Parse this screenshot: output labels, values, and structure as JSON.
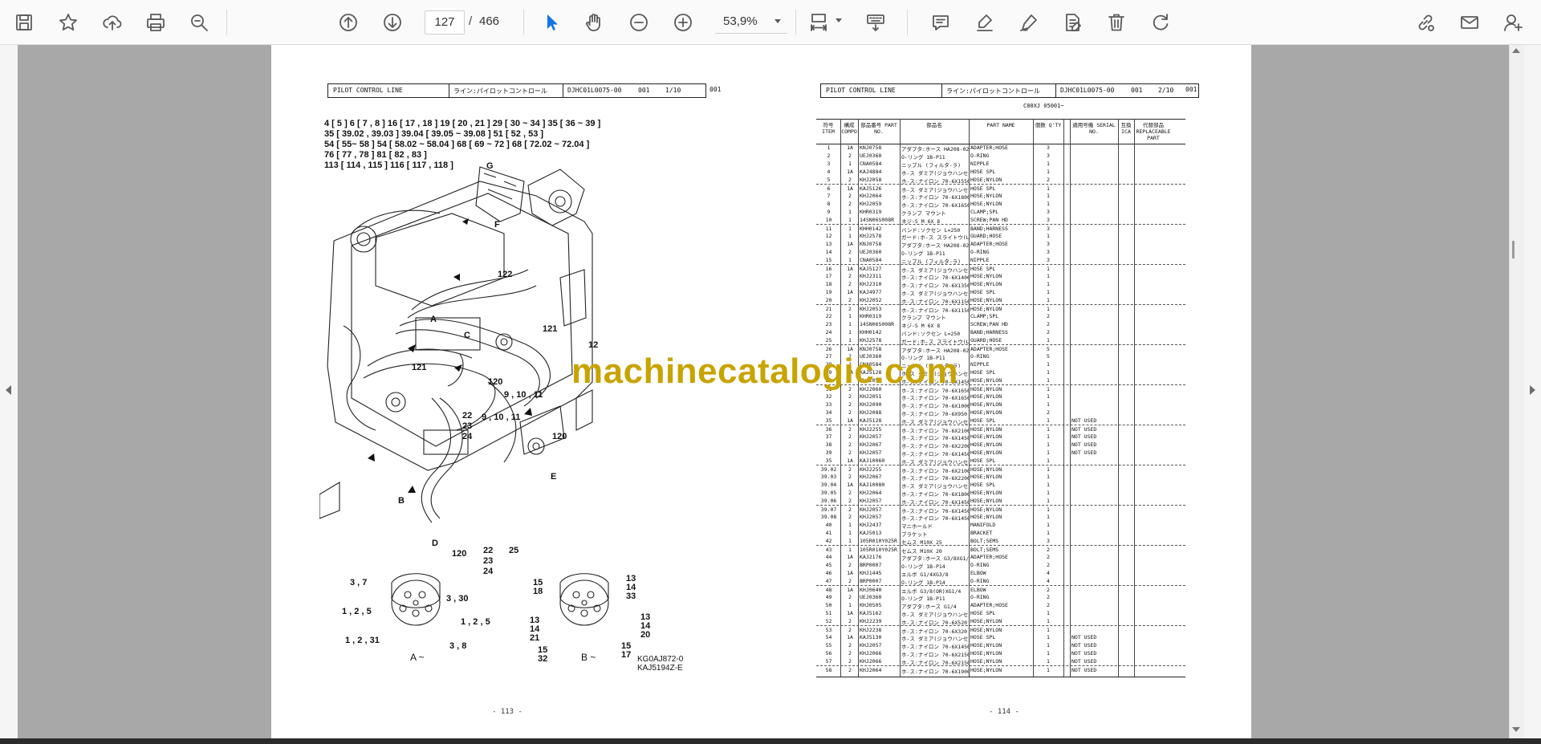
{
  "toolbar": {
    "page_current": "127",
    "page_separator": "/",
    "page_total": "466",
    "zoom": "53,9%",
    "icons": [
      "save-icon",
      "bookmark-star-icon",
      "upload-icon",
      "print-icon",
      "zoom-search-icon",
      "page-up-icon",
      "page-down-icon",
      "select-arrow-icon",
      "hand-icon",
      "zoom-out-icon",
      "zoom-in-icon",
      "fit-page-icon",
      "keyboard-icon",
      "comment-icon",
      "highlight-icon",
      "draw-icon",
      "edit-text-icon",
      "delete-icon",
      "rotate-icon",
      "share-link-icon",
      "email-icon",
      "add-user-icon"
    ],
    "accent": "#1473e6"
  },
  "watermark": "machinecatalogic.com",
  "left_page": {
    "header": {
      "title": "PILOT CONTROL LINE",
      "jp": "ライン:パイロットコントロール",
      "code": "DJHC01L0075-00",
      "rev": "001",
      "page": "1/10",
      "tail": "001"
    },
    "refs": [
      "4 [ 5 ]     6 [ 7 , 8 ]     16 [ 17 , 18 ]    19 [ 20 , 21 ]    29 [ 30 ~ 34 ]    35 [ 36 ~ 39 ]",
      "35 [ 39.02 , 39.03 ]    39.04 [ 39.05 ~ 39.08 ]     51 [ 52 , 53 ]",
      "54 [ 55~ 58 ]      54 [ 58.02 ~ 58.04 ]     68 [ 69 ~ 72 ]    68 [ 72.02 ~ 72.04 ]",
      "76 [ 77 , 78 ]     81 [ 82 , 83 ]",
      "113 [ 114 , 115 ]     116 [ 117 , 118 ]"
    ],
    "callouts": [
      "G",
      "F",
      "122",
      "A",
      "C",
      "121",
      "12",
      "121",
      "120",
      "9 , 10 , 11",
      "22",
      "23",
      "24",
      "9 , 10 , 11",
      "120",
      "E",
      "B",
      "D",
      "120",
      "22",
      "23",
      "24",
      "25"
    ],
    "detailA": {
      "labels": [
        "3 , 7",
        "3 , 30",
        "1 , 2 , 5",
        "1 , 2 , 5",
        "1 , 2 , 31",
        "3 , 8"
      ],
      "caption": "A ~"
    },
    "detailB": {
      "labels": [
        "13",
        "14",
        "33",
        "15",
        "18",
        "13",
        "14",
        "20",
        "13",
        "14",
        "21",
        "15",
        "32",
        "15",
        "17"
      ],
      "caption": "B ~"
    },
    "drawing_codes": [
      "KG0AJ872-0",
      "KAJ5194Z-E"
    ],
    "page_number": "- 113 -"
  },
  "right_page": {
    "header": {
      "title": "PILOT CONTROL LINE",
      "jp": "ライン:パイロットコントロール",
      "code": "DJHC01L0075-00",
      "rev": "001",
      "page": "2/10",
      "tail": "001"
    },
    "serial": "C80XJ 05001~",
    "columns": [
      "符号 ITEM",
      "構成 COMPO",
      "部品番号 PART NO.",
      "部品名",
      "PART NAME",
      "個数 Q'TY",
      "適用号機 SERIAL NO.",
      "互換 ICA",
      "代替部品 REPLACEABLE PART"
    ],
    "rows": [
      [
        "1",
        "1A",
        "KNJ0758",
        "アダプタ:ホース HA208-02",
        "ADAPTER;HOSE",
        "3",
        ""
      ],
      [
        "2",
        "2",
        "UEJ0360",
        "O-リング 1B-P11",
        "O-RING",
        "3",
        ""
      ],
      [
        "3",
        "1",
        "CNA0584",
        "ニップル (フィルタ-ラ)",
        "NIPPLE",
        "1",
        ""
      ],
      [
        "4",
        "1A",
        "KAJ4884",
        "ホ-ス ダミア(ジョウハンセイ",
        "HOSE SPL",
        "1",
        ""
      ],
      [
        "5",
        "2",
        "KHJ2058",
        "ホ-ス:ナイロン 70-6X1550 5",
        "HOSE;NYLON",
        "2",
        ""
      ],
      [
        "6",
        "1A",
        "KAJ5126",
        "ホ-ス ダミア(ジョウハンセイ",
        "HOSE SPL",
        "1",
        ""
      ],
      [
        "7",
        "2",
        "KHJ2064",
        "ホ-ス:ナイロン 70-6X1800 5",
        "HOSE;NYLON",
        "1",
        ""
      ],
      [
        "8",
        "2",
        "KHJ2059",
        "ホ-ス:ナイロン 70-6X1650 5",
        "HOSE;NYLON",
        "1",
        ""
      ],
      [
        "9",
        "1",
        "KHR0319",
        "クランプ マウント",
        "CLAMP;SPL",
        "3",
        ""
      ],
      [
        "10",
        "1",
        "14SN06S008R",
        "ネジ-S M 6X 8",
        "SCREW;PAN HD",
        "3",
        ""
      ],
      [
        "11",
        "1",
        "KHH0142",
        "バンド:ソクセン L=250",
        "BAND;HARNESS",
        "3",
        ""
      ],
      [
        "12",
        "1",
        "KHJ2578",
        "ガード:ホ-ス スライトウ(L=3",
        "GUARD;HOSE",
        "1",
        ""
      ],
      [
        "13",
        "1A",
        "KNJ0758",
        "アダプタ:ホース HA208-02",
        "ADAPTER;HOSE",
        "3",
        ""
      ],
      [
        "14",
        "2",
        "UEJ0360",
        "O-リング 1B-P11",
        "O-RING",
        "3",
        ""
      ],
      [
        "15",
        "1",
        "CNA0584",
        "ニップル (フィルタ-ラ)",
        "NIPPLE",
        "3",
        ""
      ],
      [
        "16",
        "1A",
        "KAJ5127",
        "ホ-ス ダミア(ジョウハンセイ",
        "HOSE SPL",
        "1",
        ""
      ],
      [
        "17",
        "2",
        "KHJ2311",
        "ホ-ス:ナイロン 70-6X1400 5",
        "HOSE;NYLON",
        "1",
        ""
      ],
      [
        "18",
        "2",
        "KHJ2310",
        "ホ-ス:ナイロン 70-6X1350 5",
        "HOSE;NYLON",
        "1",
        ""
      ],
      [
        "19",
        "1A",
        "KAJ4977",
        "ホ-ス ダミア(ジョウハンセイ",
        "HOSE SPL",
        "1",
        ""
      ],
      [
        "20",
        "2",
        "KHJ2052",
        "ホ-ス:ナイロン 70-6X1150 5",
        "HOSE;NYLON",
        "1",
        ""
      ],
      [
        "21",
        "2",
        "KHJ2053",
        "ホ-ス:ナイロン 70-6X1150 5",
        "HOSE;NYLON",
        "1",
        ""
      ],
      [
        "22",
        "1",
        "KHR0319",
        "クランプ マウント",
        "CLAMP;SPL",
        "2",
        ""
      ],
      [
        "23",
        "1",
        "14SN06S008R",
        "ネジ-S M 6X 8",
        "SCREW;PAN HD",
        "2",
        ""
      ],
      [
        "24",
        "1",
        "KHH0142",
        "バンド:ソクセン L=250",
        "BAND;HARNESS",
        "2",
        ""
      ],
      [
        "25",
        "1",
        "KHJ2578",
        "ガード:ホ-ス スライトウ(L=3",
        "GUARD;HOSE",
        "1",
        ""
      ],
      [
        "26",
        "1A",
        "KNJ0758",
        "アダプタ:ホース HA208-02",
        "ADAPTER;HOSE",
        "5",
        ""
      ],
      [
        "27",
        "2",
        "UEJ0360",
        "O-リング 1B-P11",
        "O-RING",
        "5",
        ""
      ],
      [
        "28",
        "1",
        "CNA0584",
        "ニップル (フィルタ-ラ)",
        "NIPPLE",
        "1",
        ""
      ],
      [
        "29",
        "1A",
        "KAJ5128",
        "ホ-ス ダミア(ジョウハンセイ",
        "HOSE SPL",
        "1",
        ""
      ],
      [
        "30",
        "2",
        "KHJ2057",
        "ホ-ス:ナイロン 70-6X1450 5",
        "HOSE;NYLON",
        "1",
        ""
      ],
      [
        "31",
        "2",
        "KHJ2060",
        "ホ-ス:ナイロン 70-6X1650 5",
        "HOSE;NYLON",
        "1",
        ""
      ],
      [
        "32",
        "2",
        "KHJ2051",
        "ホ-ス:ナイロン 70-6X1650 5",
        "HOSE;NYLON",
        "1",
        ""
      ],
      [
        "33",
        "2",
        "KHJ2090",
        "ホ-ス:ナイロン 70-6X1000 5",
        "HOSE;NYLON",
        "1",
        ""
      ],
      [
        "34",
        "2",
        "KHJ2088",
        "ホ-ス:ナイロン 70-6X950 54",
        "HOSE;NYLON",
        "2",
        ""
      ],
      [
        "35",
        "1A",
        "KAJ5128",
        "ホ-ス ダミア(ジョウハンセイ",
        "HOSE SPL",
        "1",
        "NOT USED"
      ],
      [
        "36",
        "2",
        "KHJ2255",
        "ホ-ス:ナイロン 70-6X2100 5",
        "HOSE;NYLON",
        "1",
        "NOT USED"
      ],
      [
        "37",
        "2",
        "KHJ2057",
        "ホ-ス:ナイロン 70-6X1450 5",
        "HOSE;NYLON",
        "1",
        "NOT USED"
      ],
      [
        "38",
        "2",
        "KHJ2067",
        "ホ-ス:ナイロン 70-6X2200 5",
        "HOSE;NYLON",
        "1",
        "NOT USED"
      ],
      [
        "39",
        "2",
        "KHJ2057",
        "ホ-ス:ナイロン 70-6X1450 5",
        "HOSE;NYLON",
        "1",
        "NOT USED"
      ],
      [
        "35",
        "1A",
        "KAJ10060",
        "ホ-ス ダミア(ジョウハンセイ",
        "HOSE SPL",
        "1",
        ""
      ],
      [
        "39.02",
        "2",
        "KHJ2255",
        "ホ-ス:ナイロン 70-6X2100 5",
        "HOSE;NYLON",
        "1",
        ""
      ],
      [
        "39.03",
        "2",
        "KHJ2067",
        "ホ-ス:ナイロン 70-6X2200 5",
        "HOSE;NYLON",
        "1",
        ""
      ],
      [
        "39.04",
        "1A",
        "KAJ10080",
        "ホ-ス ダミア(ジョウハンセイ",
        "HOSE SPL",
        "1",
        ""
      ],
      [
        "39.05",
        "2",
        "KHJ2064",
        "ホ-ス:ナイロン 70-6X1800 5",
        "HOSE;NYLON",
        "1",
        ""
      ],
      [
        "39.06",
        "2",
        "KHJ2057",
        "ホ-ス:ナイロン 70-6X1450 5",
        "HOSE;NYLON",
        "1",
        ""
      ],
      [
        "39.07",
        "2",
        "KHJ2057",
        "ホ-ス:ナイロン 70-6X1450 5",
        "HOSE;NYLON",
        "1",
        ""
      ],
      [
        "39.08",
        "2",
        "KHJ2057",
        "ホ-ス:ナイロン 70-6X1450 5",
        "HOSE;NYLON",
        "1",
        ""
      ],
      [
        "40",
        "1",
        "KHJ2437",
        "マニホールド",
        "MANIFOLD",
        "1",
        ""
      ],
      [
        "41",
        "1",
        "KAJ5013",
        "ブラケット",
        "BRACKET",
        "1",
        ""
      ],
      [
        "42",
        "1",
        "105R010Y025R",
        "セムス M10X 25",
        "BOLT;SEMS",
        "3",
        ""
      ],
      [
        "43",
        "1",
        "105R010Y025R",
        "セムス M10X 20",
        "BOLT;SEMS",
        "2",
        ""
      ],
      [
        "44",
        "1A",
        "KAJ2176",
        "アダプタ:ホース G3/8XG1/4",
        "ADAPTER;HOSE",
        "2",
        ""
      ],
      [
        "45",
        "2",
        "BRP0007",
        "O-リング 1B-P14",
        "O-RING",
        "2",
        ""
      ],
      [
        "46",
        "1A",
        "KHJ1445",
        "エルボ G1/4XG3/8",
        "ELBOW",
        "4",
        ""
      ],
      [
        "47",
        "2",
        "BRP0007",
        "O-リング 1B-P14",
        "O-RING",
        "4",
        ""
      ],
      [
        "48",
        "1A",
        "KHJ0640",
        "エルボ G3/8(OR)XG1/4",
        "ELBOW",
        "2",
        ""
      ],
      [
        "49",
        "2",
        "UEJ0360",
        "O-リング 1B-P11",
        "O-RING",
        "2",
        ""
      ],
      [
        "50",
        "1",
        "KHJ0505",
        "アダプタ:ホース G1/4",
        "ADAPTER;HOSE",
        "2",
        ""
      ],
      [
        "51",
        "1A",
        "KAJ5162",
        "ホ-ス ダミア(ジョウハンセイ",
        "HOSE SPL",
        "1",
        ""
      ],
      [
        "52",
        "2",
        "KHJ2239",
        "ホ-ス:ナイロン 70-6X520 54",
        "HOSE;NYLON",
        "1",
        ""
      ],
      [
        "53",
        "2",
        "KHJ2238",
        "ホ-ス:ナイロン 70-6X320 54",
        "HOSE;NYLON",
        "1",
        ""
      ],
      [
        "54",
        "1A",
        "KAJ5130",
        "ホ-ス ダミア(ジョウハンセイ",
        "HOSE SPL",
        "1",
        "NOT USED"
      ],
      [
        "55",
        "2",
        "KHJ2057",
        "ホ-ス:ナイロン 70-6X1450 5",
        "HOSE;NYLON",
        "1",
        "NOT USED"
      ],
      [
        "56",
        "2",
        "KHJ2066",
        "ホ-ス:ナイロン 70-6X2150 5",
        "HOSE;NYLON",
        "1",
        "NOT USED"
      ],
      [
        "57",
        "2",
        "KHJ2066",
        "ホ-ス:ナイロン 70-6X2150 5",
        "HOSE;NYLON",
        "1",
        "NOT USED"
      ],
      [
        "58",
        "2",
        "KHJ2064",
        "ホ-ス:ナイロン 70-6X1900 5",
        "HOSE;NYLON",
        "1",
        "NOT USED"
      ]
    ],
    "page_number": "- 114 -"
  }
}
